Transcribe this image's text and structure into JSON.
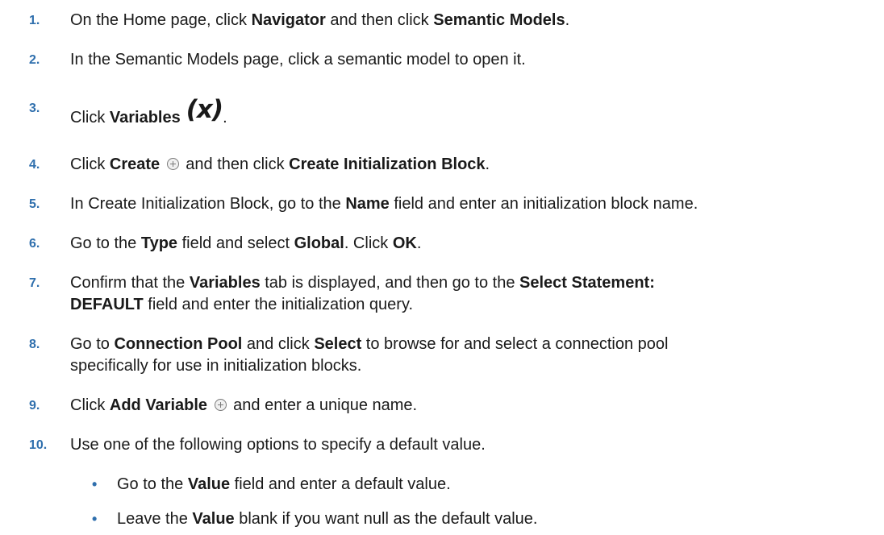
{
  "steps": [
    {
      "num": "1.",
      "parts": [
        {
          "t": "On the Home page, click "
        },
        {
          "t": "Navigator",
          "b": true
        },
        {
          "t": " and then click "
        },
        {
          "t": "Semantic Models",
          "b": true
        },
        {
          "t": "."
        }
      ]
    },
    {
      "num": "2.",
      "parts": [
        {
          "t": "In the Semantic Models page, click a semantic model to open it."
        }
      ]
    },
    {
      "num": "3.",
      "parts": [
        {
          "t": "Click "
        },
        {
          "t": "Variables",
          "b": true
        }
      ],
      "icon": "(x)",
      "after_icon": "."
    },
    {
      "num": "4.",
      "pre": [
        {
          "t": "Click "
        },
        {
          "t": "Create",
          "b": true
        }
      ],
      "post": [
        {
          "t": " and then click "
        },
        {
          "t": "Create Initialization Block",
          "b": true
        },
        {
          "t": "."
        }
      ]
    },
    {
      "num": "5.",
      "parts": [
        {
          "t": "In Create Initialization Block, go to the "
        },
        {
          "t": "Name",
          "b": true
        },
        {
          "t": " field and enter an initialization block name."
        }
      ]
    },
    {
      "num": "6.",
      "parts": [
        {
          "t": "Go to the "
        },
        {
          "t": "Type",
          "b": true
        },
        {
          "t": " field and select "
        },
        {
          "t": "Global",
          "b": true
        },
        {
          "t": ". Click "
        },
        {
          "t": "OK",
          "b": true
        },
        {
          "t": "."
        }
      ]
    },
    {
      "num": "7.",
      "line1": [
        {
          "t": "Confirm that the "
        },
        {
          "t": "Variables",
          "b": true
        },
        {
          "t": " tab is displayed, and then go to the "
        },
        {
          "t": "Select Statement:",
          "b": true
        }
      ],
      "line2": [
        {
          "t": "DEFAULT",
          "b": true
        },
        {
          "t": " field and enter the initialization query."
        }
      ]
    },
    {
      "num": "8.",
      "line1": [
        {
          "t": "Go to "
        },
        {
          "t": "Connection Pool",
          "b": true
        },
        {
          "t": " and click "
        },
        {
          "t": "Select",
          "b": true
        },
        {
          "t": " to browse for and select a connection pool"
        }
      ],
      "line2": [
        {
          "t": "specifically for use in initialization blocks."
        }
      ]
    },
    {
      "num": "9.",
      "pre": [
        {
          "t": "Click "
        },
        {
          "t": "Add Variable",
          "b": true
        }
      ],
      "post": [
        {
          "t": " and enter a unique name."
        }
      ]
    },
    {
      "num": "10.",
      "parts": [
        {
          "t": "Use one of the following options to specify a default value."
        }
      ]
    }
  ],
  "bullets": [
    {
      "mark": "•",
      "parts": [
        {
          "t": "Go to the "
        },
        {
          "t": "Value",
          "b": true
        },
        {
          "t": " field and enter a default value."
        }
      ]
    },
    {
      "mark": "•",
      "parts": [
        {
          "t": "Leave the "
        },
        {
          "t": "Value",
          "b": true
        },
        {
          "t": " blank if you want null as the default value."
        }
      ]
    }
  ],
  "icons": {
    "variables": "variables-icon",
    "create": "plus-circle-icon",
    "add_variable": "plus-circle-icon"
  },
  "colors": {
    "step_number": "#2f6fad",
    "text": "#1a1a1a"
  }
}
